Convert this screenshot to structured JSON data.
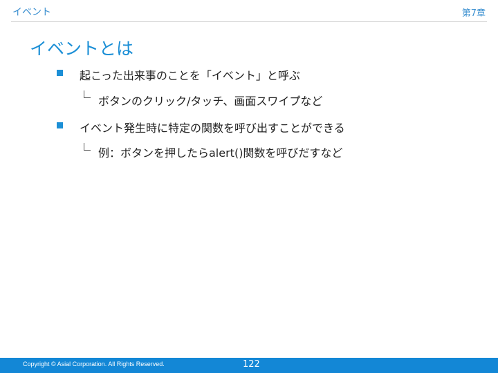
{
  "header": {
    "section_title": "イベント",
    "chapter": "第7章"
  },
  "slide": {
    "title": "イベントとは",
    "bullets": [
      {
        "text": "起こった出来事のことを「イベント」と呼ぶ",
        "sub": "ボタンのクリック/タッチ、画面スワイプなど"
      },
      {
        "text": "イベント発生時に特定の関数を呼び出すことができる",
        "sub": "例：ボタンを押したらalert()関数を呼びだすなど"
      }
    ]
  },
  "footer": {
    "copyright": "Copyright © Asial Corporation. All Rights Reserved.",
    "page_number": "122"
  },
  "colors": {
    "accent": "#1c8fd6",
    "footer_bg": "#1387d6"
  }
}
